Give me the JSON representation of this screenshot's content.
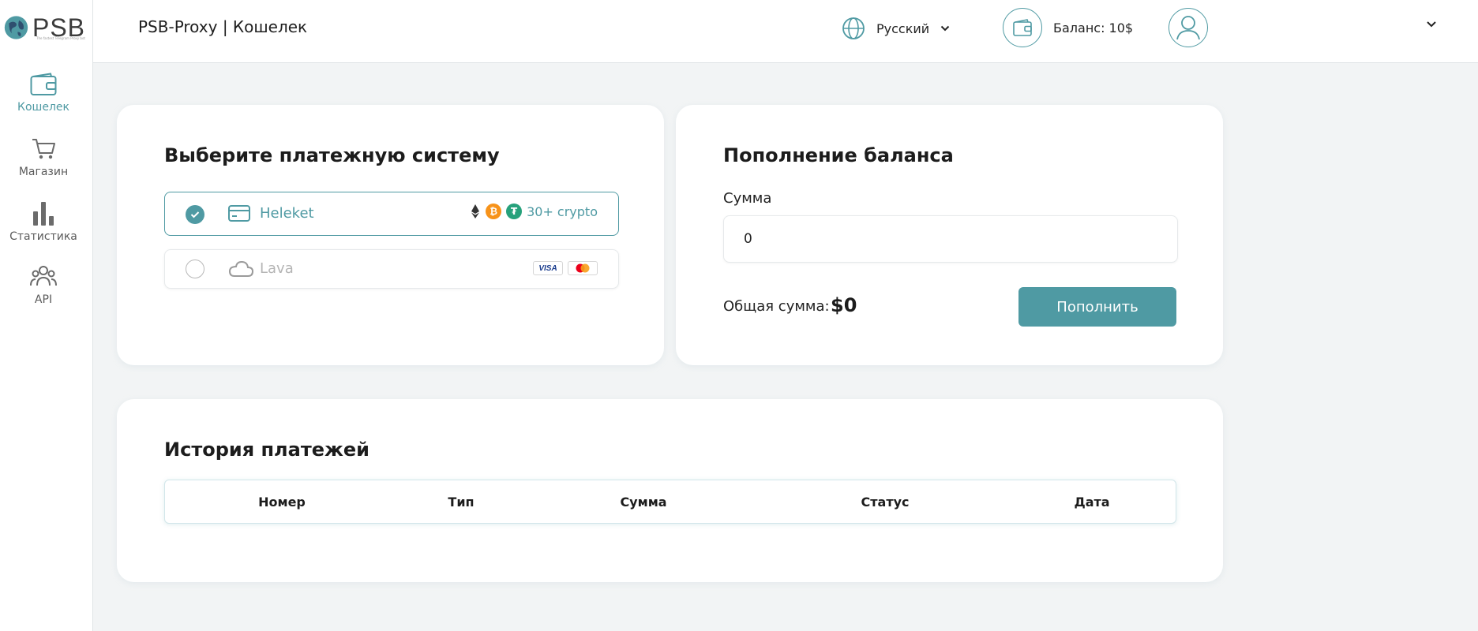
{
  "logo": {
    "text": "PSB",
    "subtitle": "The fastest Telegram Proxy bot"
  },
  "sidebar": {
    "items": [
      {
        "label": "Кошелек",
        "icon": "wallet-icon",
        "active": true
      },
      {
        "label": "Магазин",
        "icon": "cart-icon",
        "active": false
      },
      {
        "label": "Статистика",
        "icon": "bar-chart-icon",
        "active": false
      },
      {
        "label": "API",
        "icon": "users-icon",
        "active": false
      }
    ]
  },
  "header": {
    "title": "PSB-Proxy | Кошелек",
    "language": "Русский",
    "balance": "Баланс: 10$"
  },
  "payment_systems": {
    "title": "Выберите платежную систему",
    "options": [
      {
        "name": "Heleket",
        "selected": true,
        "extra": "30+ crypto",
        "icon": "card-icon"
      },
      {
        "name": "Lava",
        "selected": false,
        "icon": "cloud-icon",
        "badges": [
          "VISA",
          "mastercard"
        ]
      }
    ]
  },
  "topup": {
    "title": "Пополнение баланса",
    "amount_label": "Сумма",
    "amount_value": "0",
    "total_label": "Общая сумма:",
    "total_value": "$0",
    "button": "Пополнить"
  },
  "history": {
    "title": "История платежей",
    "columns": [
      "Номер",
      "Тип",
      "Сумма",
      "Статус",
      "Дата"
    ]
  },
  "colors": {
    "accent": "#4f9aa3",
    "background": "#f2f4f5"
  }
}
